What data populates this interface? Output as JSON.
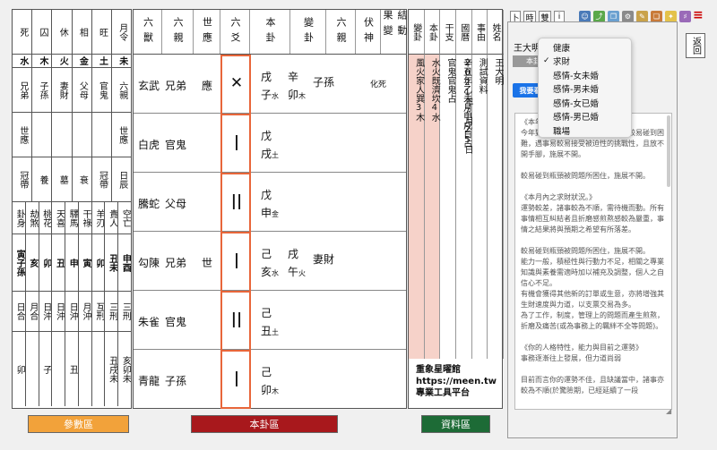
{
  "params": {
    "rows": [
      [
        "死",
        "囚",
        "休",
        "相",
        "旺",
        "月令"
      ],
      [
        "水",
        "木",
        "火",
        "金",
        "土",
        "未"
      ],
      [
        "兄弟",
        "子孫",
        "妻財",
        "父母",
        "官鬼",
        "六親"
      ],
      [
        "世應",
        "",
        "",
        "",
        "",
        "世應"
      ],
      [
        "冠帶",
        "養",
        "墓",
        "衰",
        "冠帶",
        "日辰"
      ],
      [
        "卦身",
        "劫煞",
        "桃花",
        "天喜",
        "驛馬",
        "干祿",
        "羊刃",
        "貴人",
        "空亡"
      ],
      [
        "寅子孫",
        "亥",
        "卯",
        "丑",
        "申",
        "寅",
        "卯",
        "丑未",
        "申酉"
      ],
      [
        "日合",
        "月合",
        "日沖",
        "日沖",
        "日沖",
        "月沖",
        "互刑",
        "三刑",
        "三刑"
      ],
      [
        "卯",
        "",
        "子",
        "",
        "丑",
        "",
        "",
        "丑戌未",
        "亥卯未"
      ]
    ]
  },
  "main": {
    "headers": [
      "六獸",
      "六親",
      "世應",
      "六爻",
      "本卦",
      "變卦",
      "六親",
      "伏神",
      "結動果變"
    ],
    "rows": [
      {
        "god": "玄武",
        "rel": "兄弟",
        "mark": "應",
        "line": "✕",
        "orig": "戌",
        "orig_sub": "",
        "orig2": "子",
        "orig2_sub": "水",
        "chg": "辛",
        "chg2": "卯",
        "chg2_sub": "木",
        "chg_rel": "子孫",
        "result": "化死"
      },
      {
        "god": "白虎",
        "rel": "官鬼",
        "mark": "",
        "line": "|",
        "orig": "戊",
        "orig_sub": "",
        "orig2": "戌",
        "orig2_sub": "土",
        "chg": "",
        "chg2": "",
        "chg2_sub": "",
        "chg_rel": "",
        "result": ""
      },
      {
        "god": "騰蛇",
        "rel": "父母",
        "mark": "",
        "line": "||",
        "orig": "戊",
        "orig_sub": "",
        "orig2": "申",
        "orig2_sub": "金",
        "chg": "",
        "chg2": "",
        "chg2_sub": "",
        "chg_rel": "",
        "result": ""
      },
      {
        "god": "勾陳",
        "rel": "兄弟",
        "mark": "世",
        "line": "|",
        "orig": "己",
        "orig_sub": "",
        "orig2": "亥",
        "orig2_sub": "水",
        "chg": "戌",
        "chg2": "午",
        "chg2_sub": "火",
        "chg_rel": "妻財",
        "result": ""
      },
      {
        "god": "朱雀",
        "rel": "官鬼",
        "mark": "",
        "line": "||",
        "orig": "己",
        "orig_sub": "",
        "orig2": "丑",
        "orig2_sub": "土",
        "chg": "",
        "chg2": "",
        "chg2_sub": "",
        "chg_rel": "",
        "result": ""
      },
      {
        "god": "青龍",
        "rel": "子孫",
        "mark": "",
        "line": "|",
        "orig": "己",
        "orig_sub": "",
        "orig2": "卯",
        "orig2_sub": "木",
        "chg": "",
        "chg2": "",
        "chg2_sub": "",
        "chg_rel": "",
        "result": ""
      }
    ]
  },
  "info": {
    "headers": [
      "變卦",
      "本卦",
      "干支",
      "國曆",
      "事由",
      "姓名"
    ],
    "cols": [
      "風火家人巽3木",
      "水火既濟坎4水",
      "官鬼官鬼占",
      "辛丑年乙未月甲戌日占",
      "2021年7月25日",
      "測試資料",
      "王大明"
    ],
    "brand": [
      "重象星曜館",
      "https://meen.tw",
      "專業工具平台"
    ]
  },
  "bottom": {
    "params_label": "參數區",
    "main_label": "本卦區",
    "info_label": "資料區"
  },
  "colors": {
    "params_btn": "#f2a23a",
    "main_btn": "#a8181c",
    "info_btn": "#1d6b36",
    "accent": "#e8663a"
  },
  "right": {
    "tabs": [
      "卜",
      "時",
      "雙",
      "i"
    ],
    "icons": [
      "user-icon",
      "share-icon",
      "copy-icon",
      "settings-icon",
      "pencil-icon",
      "book-icon",
      "person-icon",
      "chart-icon"
    ],
    "username": "王大明 先生",
    "interp_label": "本卦解說版",
    "view_label": "我要看論斷",
    "back_label": "返回",
    "menu": [
      "健康",
      "求財",
      "感情-女未婚",
      "感情-男未婚",
      "感情-女已婚",
      "感情-男已婚",
      "職場"
    ],
    "menu_selected": "求財",
    "paragraphs": [
      "《本年度內之求財狀況》",
      "今年對你來說，處於發展期，諸事較易碰到困難，遇事易較易接受被迫性的挑戰性，且放不開手腳，施展不開。",
      "較易碰到瓶頸被問題所困住，施展不開。",
      "《本月內之求財狀況。》",
      "運勢較差，諸事較為不順，需待機而動。所有事情相互糾結者且折磨感煎熬感較為嚴重，事情之結果將與預期之希望有所落差。",
      "較易碰到瓶頸被問題所困住，施展不開。",
      "能力一般，積極性與行動力不足，相關之專業知識與素養需適時加以補充及調整，個人之自信心不足。",
      "有機會獲得其他新的訂單或生意，亦將增強其生財速度與力道，以支票交易為多。",
      "為了工作，制度，管理上的問題而產生煎熬，折磨及痛苦(或為事務上的羈絆不全等問題)。",
      "《你的人格特性，能力與目前之運勢》",
      "事務逐漸往上發展，但力道尚弱",
      "目前而言你的運勢不佳，且缺議當中，諸事亦較為不順(於驚險期，已經延續了一段"
    ]
  }
}
